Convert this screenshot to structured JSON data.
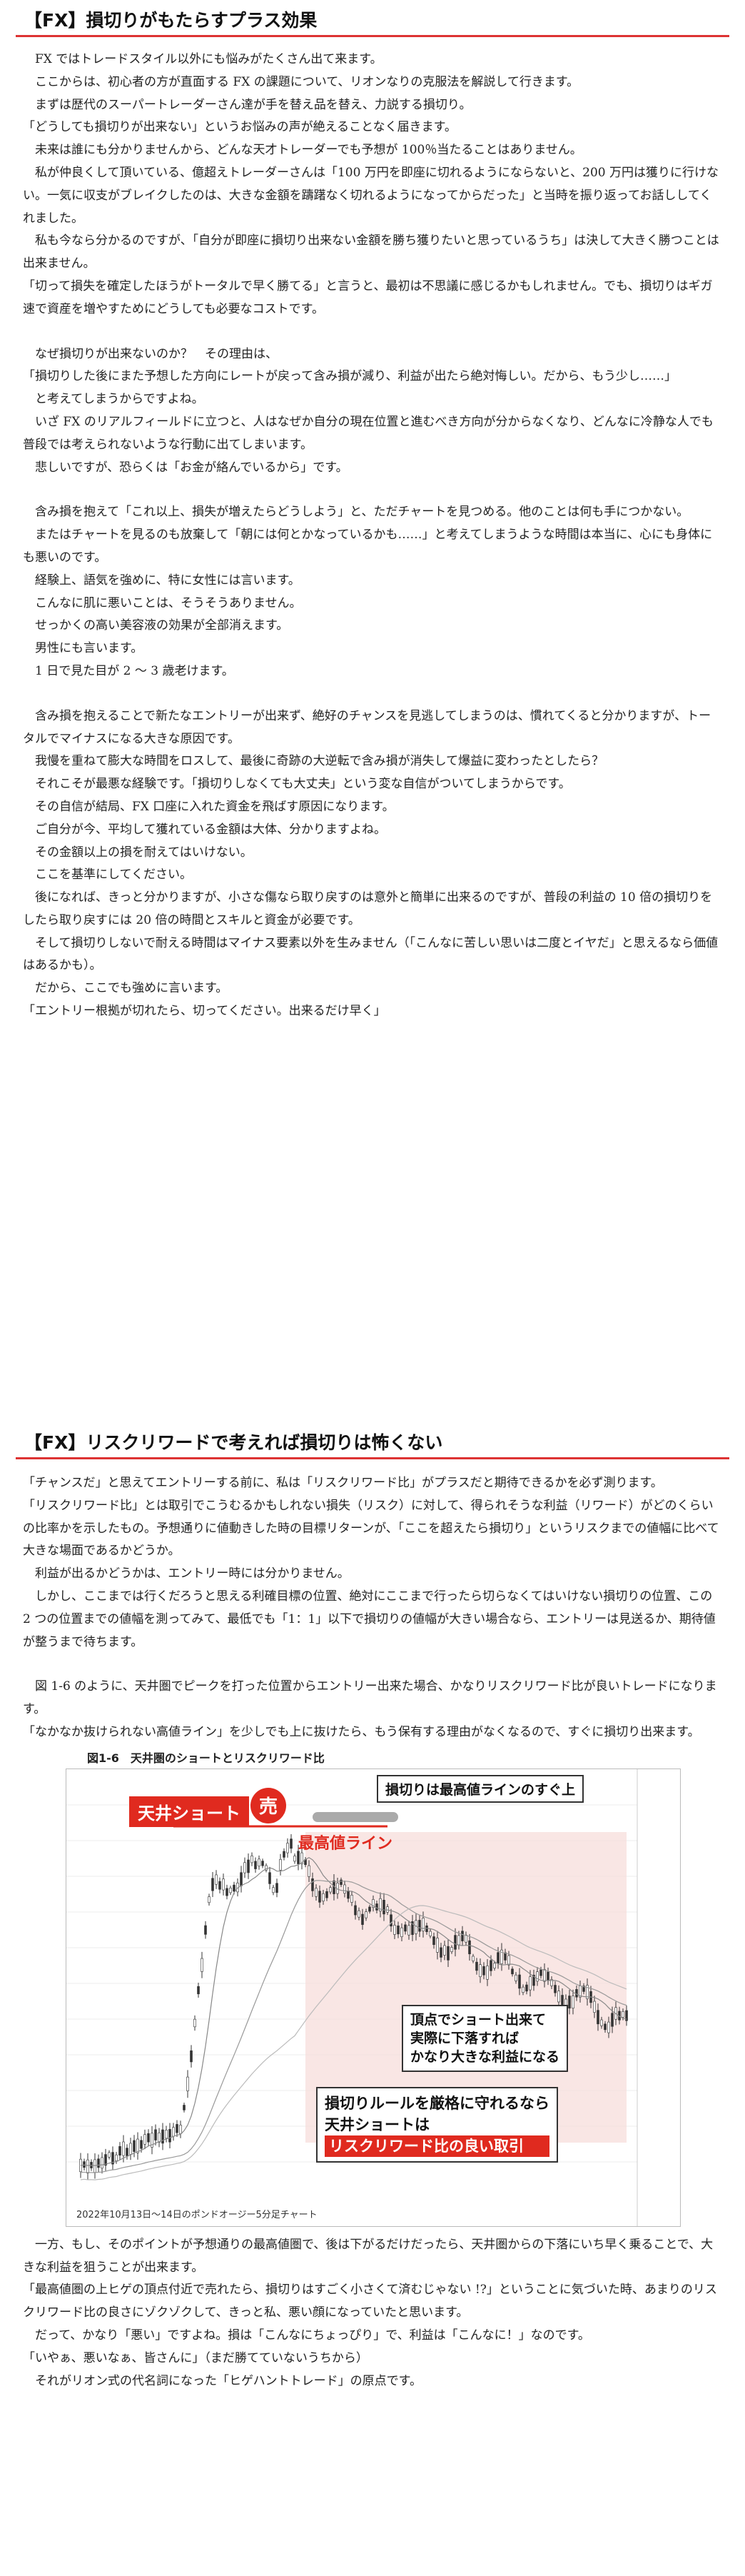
{
  "section1": {
    "heading": "【FX】損切りがもたらすプラス効果",
    "lines": [
      "　FX ではトレードスタイル以外にも悩みがたくさん出て来ます。",
      "　ここからは、初心者の方が直面する FX の課題について、リオンなりの克服法を解説して行きます。",
      "　まずは歴代のスーパートレーダーさん達が手を替え品を替え、力説する損切り。",
      "「どうしても損切りが出来ない」というお悩みの声が絶えることなく届きます。",
      "　未来は誰にも分かりませんから、どんな天才トレーダーでも予想が 100％当たることはありません。",
      "　私が仲良くして頂いている、億超えトレーダーさんは「100 万円を即座に切れるようにならないと、200 万円は獲りに行けない。一気に収支がブレイクしたのは、大きな金額を躊躇なく切れるようになってからだった」と当時を振り返ってお話ししてくれました。",
      "　私も今なら分かるのですが、「自分が即座に損切り出来ない金額を勝ち獲りたいと思っているうち」は決して大きく勝つことは出来ません。",
      "「切って損失を確定したほうがトータルで早く勝てる」と言うと、最初は不思議に感じるかもしれません。でも、損切りはギガ速で資産を増やすためにどうしても必要なコストです。",
      "",
      "　なぜ損切りが出来ないのか？　その理由は、",
      "「損切りした後にまた予想した方向にレートが戻って含み損が減り、利益が出たら絶対悔しい。だから、もう少し……」",
      "　と考えてしまうからですよね。",
      "　いざ FX のリアルフィールドに立つと、人はなぜか自分の現在位置と進むべき方向が分からなくなり、どんなに冷静な人でも普段では考えられないような行動に出てしまいます。",
      "　悲しいですが、恐らくは「お金が絡んでいるから」です。",
      "",
      "　含み損を抱えて「これ以上、損失が増えたらどうしよう」と、ただチャートを見つめる。他のことは何も手につかない。",
      "　またはチャートを見るのも放棄して「朝には何とかなっているかも……」と考えてしまうような時間は本当に、心にも身体にも悪いのです。",
      "　経験上、語気を強めに、特に女性には言います。",
      "　こんなに肌に悪いことは、そうそうありません。",
      "　せっかくの高い美容液の効果が全部消えます。",
      "　男性にも言います。",
      "　1 日で見た目が 2 ～ 3 歳老けます。",
      "",
      "　含み損を抱えることで新たなエントリーが出来ず、絶好のチャンスを見逃してしまうのは、慣れてくると分かりますが、トータルでマイナスになる大きな原因です。",
      "　我慢を重ねて膨大な時間をロスして、最後に奇跡の大逆転で含み損が消失して爆益に変わったとしたら？",
      "　それこそが最悪な経験です。「損切りしなくても大丈夫」という変な自信がついてしまうからです。",
      "　その自信が結局、FX 口座に入れた資金を飛ばす原因になります。",
      "　ご自分が今、平均して獲れている金額は大体、分かりますよね。",
      "　その金額以上の損を耐えてはいけない。",
      "　ここを基準にしてください。",
      "　後になれば、きっと分かりますが、小さな傷なら取り戻すのは意外と簡単に出来るのですが、普段の利益の 10 倍の損切りをしたら取り戻すには 20 倍の時間とスキルと資金が必要です。",
      "　そして損切りしないで耐える時間はマイナス要素以外を生みません（「こんなに苦しい思いは二度とイヤだ」と思えるなら価値はあるかも）。",
      "　だから、ここでも強めに言います。",
      "「エントリー根拠が切れたら、切ってください。出来るだけ早く」"
    ]
  },
  "section2": {
    "heading": "【FX】リスクリワードで考えれば損切りは怖くない",
    "lines": [
      "「チャンスだ」と思えてエントリーする前に、私は「リスクリワード比」がプラスだと期待できるかを必ず測ります。",
      "「リスクリワード比」とは取引でこうむるかもしれない損失（リスク）に対して、得られそうな利益（リワード）がどのくらいの比率かを示したもの。予想通りに値動きした時の目標リターンが、「ここを超えたら損切り」というリスクまでの値幅に比べて大きな場面であるかどうか。",
      "　利益が出るかどうかは、エントリー時には分かりません。",
      "　しかし、ここまでは行くだろうと思える利確目標の位置、絶対にここまで行ったら切らなくてはいけない損切りの位置、この 2 つの位置までの値幅を測ってみて、最低でも「1：1」以下で損切りの値幅が大きい場合なら、エントリーは見送るか、期待値が整うまで待ちます。",
      "",
      "　図 1-6 のように、天井圏でピークを打った位置からエントリー出来た場合、かなりリスクリワード比が良いトレードになります。",
      "「なかなか抜けられない高値ライン」を少しでも上に抜けたら、もう保有する理由がなくなるので、すぐに損切り出来ます。"
    ],
    "lines_after": [
      "　一方、もし、そのポイントが予想通りの最高値圏で、後は下がるだけだったら、天井圏からの下落にいち早く乗ることで、大きな利益を狙うことが出来ます。",
      "「最高値圏の上ヒゲの頂点付近で売れたら、損切りはすごく小さくて済むじゃない !?」ということに気づいた時、あまりのリスクリワード比の良さにゾクゾクして、きっと私、悪い顔になっていたと思います。",
      "　だって、かなり「悪い」ですよね。損は「こんなにちょっぴり」で、利益は「こんなに！」なのです。",
      "「いやぁ、悪いなぁ、皆さんに」（まだ勝てていないうちから）",
      "　それがリオン式の代名詞になった「ヒゲハントトレード」の原点です。"
    ],
    "figure": {
      "title": "図1-6　天井圏のショートとリスクリワード比",
      "label_short": "天井ショート",
      "label_sell": "売",
      "label_top_line": "最高値ライン",
      "callout_stop": "損切りは最高値ラインのすぐ上",
      "callout_profit": "頂点でショート出来て\n実際に下落すれば\nかなり大きな利益になる",
      "callout_rule_1": "損切りルールを厳格に守れるなら",
      "callout_rule_2": "天井ショートは",
      "callout_rule_3": "リスクリワード比の良い取引",
      "caption": "2022年10月13日～14日のポンドオージー5分足チャート",
      "colors": {
        "red": "#e02a1f",
        "pink_zone": "#f6dcd8",
        "candle": "#333333"
      }
    }
  }
}
